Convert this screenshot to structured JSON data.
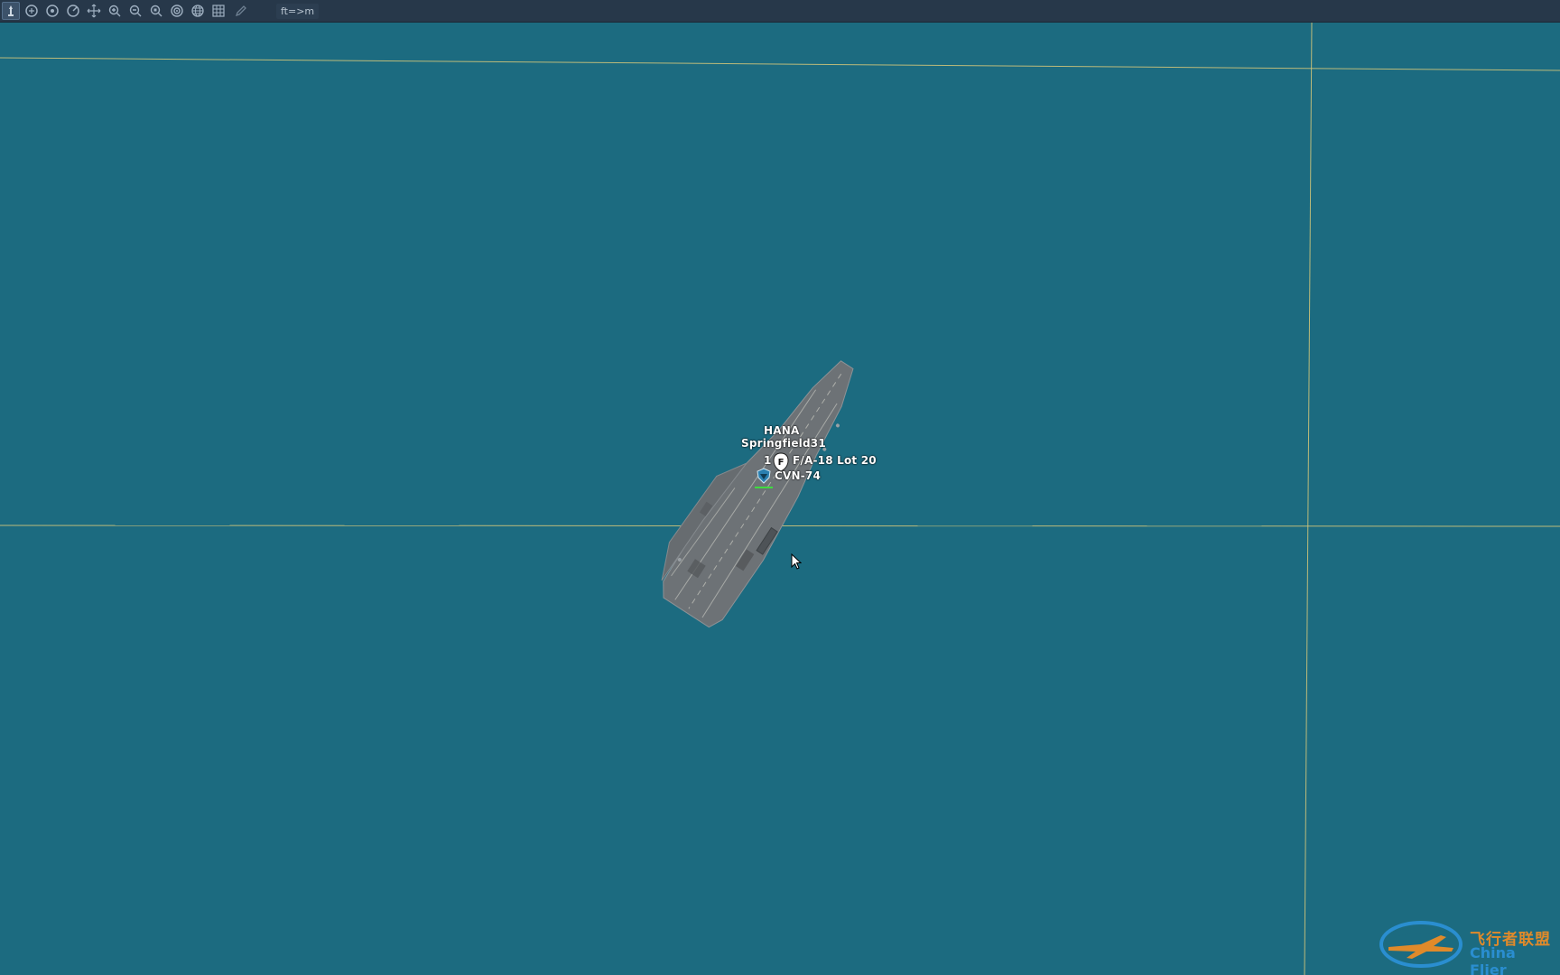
{
  "toolbar": {
    "tools": [
      {
        "name": "select-tool",
        "icon": "select-pointer-icon",
        "active": true
      },
      {
        "name": "measure-tool-a",
        "icon": "ruler-circle-icon",
        "active": false
      },
      {
        "name": "measure-tool-b",
        "icon": "ruler-circle-icon",
        "active": false
      },
      {
        "name": "measure-tool-c",
        "icon": "ruler-circle-icon",
        "active": false
      },
      {
        "name": "pan-tool",
        "icon": "pan-arrows-icon",
        "active": false
      },
      {
        "name": "zoom-in-tool",
        "icon": "zoom-in-icon",
        "active": false
      },
      {
        "name": "zoom-out-tool",
        "icon": "zoom-out-icon",
        "active": false
      },
      {
        "name": "zoom-fit-tool",
        "icon": "zoom-fit-icon",
        "active": false
      },
      {
        "name": "target-tool",
        "icon": "target-icon",
        "active": false
      },
      {
        "name": "globe-tool",
        "icon": "globe-icon",
        "active": false
      },
      {
        "name": "grid-tool",
        "icon": "grid-icon",
        "active": false
      },
      {
        "name": "draw-tool",
        "icon": "pencil-icon",
        "active": false
      }
    ],
    "unit_toggle": "ft=>m"
  },
  "map": {
    "colors": {
      "sea": "#1c6b80",
      "grid_line": "#d8c97a"
    },
    "units": [
      {
        "group_name": "HANA",
        "pilot": "Springfield31",
        "count": "1",
        "aircraft": "F/A-18 Lot 20",
        "marker_letter": "F",
        "ship": "CVN-74"
      }
    ]
  },
  "watermark": {
    "cn": "飞行者联盟",
    "en": "China Flier"
  }
}
